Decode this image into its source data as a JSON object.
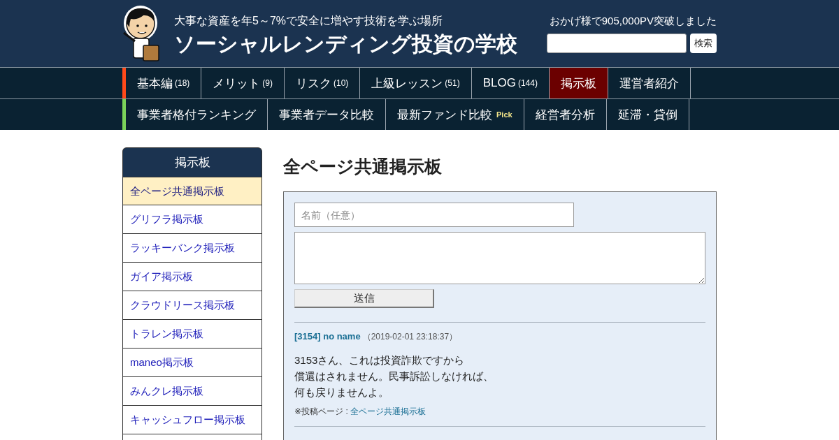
{
  "header": {
    "tagline": "大事な資産を年5～7%で安全に増やす技術を学ぶ場所",
    "site_title": "ソーシャルレンディング投資の学校",
    "pv_notice": "おかげ様で905,000PV突破しました",
    "search_button": "検索"
  },
  "nav_primary": [
    {
      "label": "基本編",
      "count": "(18)",
      "selected": false
    },
    {
      "label": "メリット",
      "count": "(9)",
      "selected": false
    },
    {
      "label": "リスク",
      "count": "(10)",
      "selected": false
    },
    {
      "label": "上級レッスン",
      "count": "(51)",
      "selected": false
    },
    {
      "label": "BLOG",
      "count": "(144)",
      "selected": false
    },
    {
      "label": "掲示板",
      "selected": true
    },
    {
      "label": "運営者紹介",
      "selected": false
    }
  ],
  "nav_secondary": [
    {
      "label": "事業者格付ランキング"
    },
    {
      "label": "事業者データ比較"
    },
    {
      "label": "最新ファンド比較",
      "badge": "Pick"
    },
    {
      "label": "経営者分析"
    },
    {
      "label": "延滞・貸倒"
    }
  ],
  "sidebar": {
    "title": "掲示板",
    "items": [
      {
        "label": "全ページ共通掲示板",
        "selected": true
      },
      {
        "label": "グリフラ掲示板",
        "selected": false
      },
      {
        "label": "ラッキーバンク掲示板",
        "selected": false
      },
      {
        "label": "ガイア掲示板",
        "selected": false
      },
      {
        "label": "クラウドリース掲示板",
        "selected": false
      },
      {
        "label": "トラレン掲示板",
        "selected": false
      },
      {
        "label": "maneo掲示板",
        "selected": false
      },
      {
        "label": "みんクレ掲示板",
        "selected": false
      },
      {
        "label": "キャッシュフロー掲示板",
        "selected": false
      }
    ]
  },
  "main": {
    "title": "全ページ共通掲示板",
    "form": {
      "name_placeholder": "名前（任意）",
      "submit": "送信"
    },
    "posts": [
      {
        "heading": "[3154] no name",
        "date": "（2019-02-01 23:18:37）",
        "lines": [
          "3153さん、これは投資詐欺ですから",
          "償還はされません。民事訴訟しなければ、",
          "何も戻りませんよ。"
        ],
        "source_label": "※投稿ページ : ",
        "source_link": "全ページ共通掲示板"
      }
    ]
  }
}
